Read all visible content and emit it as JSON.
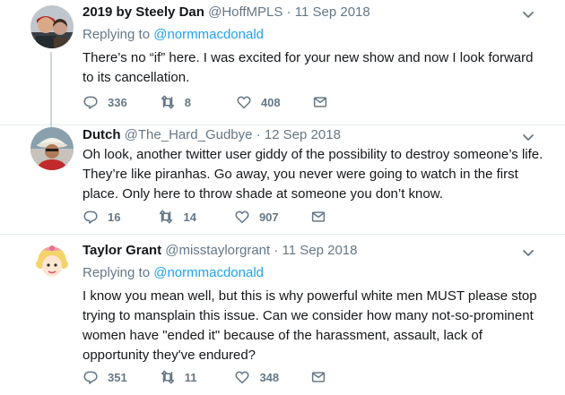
{
  "tweets": [
    {
      "name": "2019 by Steely Dan",
      "handle": "@HoffMPLS",
      "sep": "·",
      "date": "11 Sep 2018",
      "replying_label": "Replying to",
      "replying_to": "@normmacdonald",
      "text": "There’s no “if” here. I was excited for your new show and now I look forward to its cancellation.",
      "replies": "336",
      "retweets": "8",
      "likes": "408"
    },
    {
      "name": "Dutch",
      "handle": "@The_Hard_Gudbye",
      "sep": "·",
      "date": "12 Sep 2018",
      "text": "Oh look, another twitter user giddy of the possibility to destroy someone’s life. They’re like piranhas. Go away, you never were going to watch in the first place. Only here to throw shade at someone you don’t know.",
      "replies": "16",
      "retweets": "14",
      "likes": "907"
    },
    {
      "name": "Taylor Grant",
      "handle": "@misstaylorgrant",
      "sep": "·",
      "date": "11 Sep 2018",
      "replying_label": "Replying to",
      "replying_to": "@normmacdonald",
      "text": "I know you mean well, but this is why powerful white men MUST please stop trying to mansplain this issue. Can we consider how many not-so-prominent women have \"ended it\" because of the harassment, assault, lack of opportunity they've endured?",
      "replies": "351",
      "retweets": "11",
      "likes": "348"
    }
  ],
  "colors": {
    "text": "#14171a",
    "secondary": "#657786",
    "link": "#1da1f2",
    "thread_line": "#ccd6dd",
    "divider": "#e6ecf0"
  },
  "icons": [
    "reply-icon",
    "retweet-icon",
    "like-icon",
    "message-icon",
    "caret-down-icon"
  ]
}
